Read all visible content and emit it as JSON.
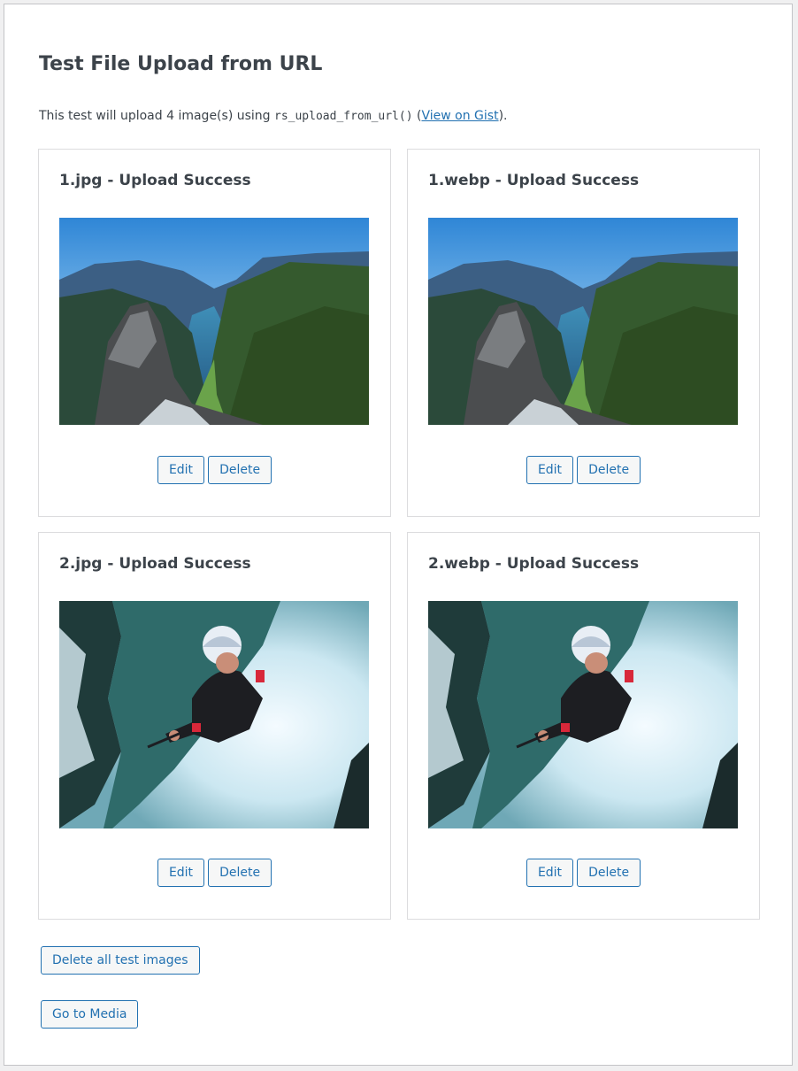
{
  "page": {
    "title": "Test File Upload from URL",
    "intro_prefix": "This test will upload 4 image(s) using ",
    "intro_code": "rs_upload_from_url()",
    "intro_paren_open": " (",
    "intro_link": "View on Gist",
    "intro_suffix": ")."
  },
  "cards": [
    {
      "title": "1.jpg - Upload Success",
      "image": "fjord landscape",
      "edit": "Edit",
      "delete": "Delete"
    },
    {
      "title": "1.webp - Upload Success",
      "image": "fjord landscape",
      "edit": "Edit",
      "delete": "Delete"
    },
    {
      "title": "2.jpg - Upload Success",
      "image": "whitewater canyoneer",
      "edit": "Edit",
      "delete": "Delete"
    },
    {
      "title": "2.webp - Upload Success",
      "image": "whitewater canyoneer",
      "edit": "Edit",
      "delete": "Delete"
    }
  ],
  "actions": {
    "delete_all": "Delete all test images",
    "go_media": "Go to Media"
  },
  "colors": {
    "accent": "#2271b1",
    "text": "#3c434a",
    "border": "#dcdcde"
  }
}
